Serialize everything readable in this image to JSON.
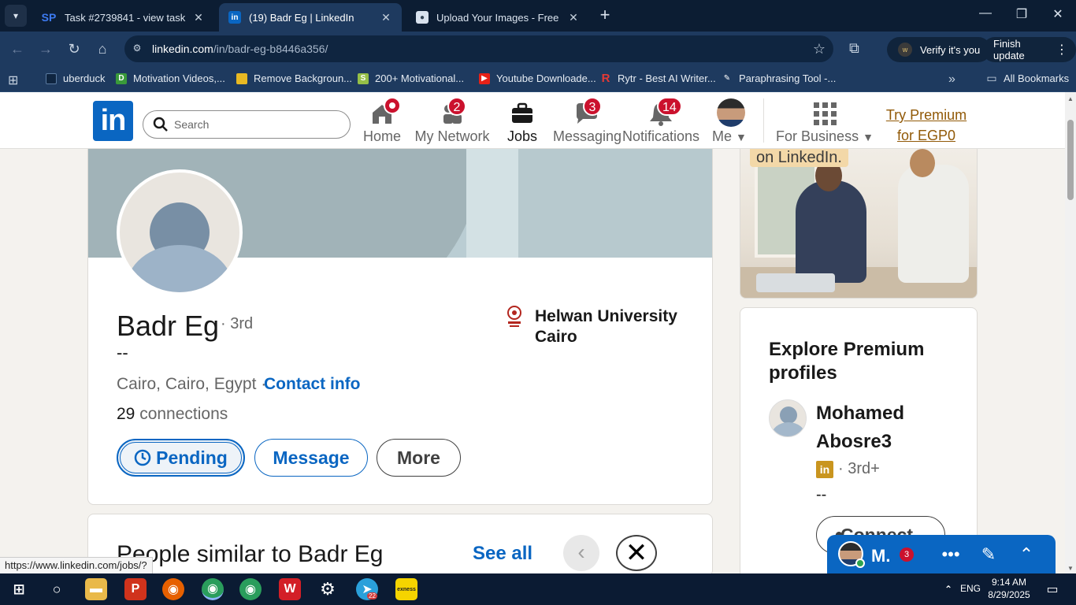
{
  "browser": {
    "tabs": [
      {
        "title": "Task #2739841 - view task",
        "favicon": "sp-icon",
        "active": false
      },
      {
        "title": "(19) Badr Eg | LinkedIn",
        "favicon": "linkedin-icon",
        "active": true
      },
      {
        "title": "Upload Your Images - Free Imag",
        "favicon": "image-host-icon",
        "active": false
      }
    ],
    "url_domain": "linkedin.com",
    "url_path": "/in/badr-eg-b8446a356/",
    "verify_label": "Verify it's you",
    "update_label": "Finish update",
    "bookmarks": [
      {
        "label": "uberduck",
        "color": "#1e3a5f"
      },
      {
        "label": "Motivation Videos,...",
        "color": "#3a9a3a"
      },
      {
        "label": "Remove Backgroun...",
        "color": "#e8b923"
      },
      {
        "label": "200+ Motivational...",
        "color": "#95bf47"
      },
      {
        "label": "Youtube Downloade...",
        "color": "#e62117"
      },
      {
        "label": "Rytr - Best AI Writer...",
        "color": "#e53935"
      },
      {
        "label": "Paraphrasing Tool -...",
        "color": "#ffffff"
      }
    ],
    "all_bookmarks_label": "All Bookmarks",
    "status_url": "https://www.linkedin.com/jobs/?"
  },
  "header": {
    "logo_text": "in",
    "search_placeholder": "Search",
    "nav": {
      "home": {
        "label": "Home",
        "badge": ""
      },
      "network": {
        "label": "My Network",
        "badge": "2"
      },
      "jobs": {
        "label": "Jobs",
        "badge": ""
      },
      "messaging": {
        "label": "Messaging",
        "badge": "3"
      },
      "notifications": {
        "label": "Notifications",
        "badge": "14"
      },
      "me": {
        "label": "Me"
      },
      "business": {
        "label": "For Business"
      }
    },
    "premium_line1": "Try Premium",
    "premium_line2": "for EGP0"
  },
  "profile": {
    "name": "Badr Eg",
    "degree": "· 3rd",
    "headline": "--",
    "location": "Cairo, Cairo, Egypt ·",
    "contact_info": "Contact info",
    "connections_count": "29",
    "connections_label": " connections",
    "buttons": {
      "pending": "Pending",
      "message": "Message",
      "more": "More"
    },
    "education": "Helwan University Cairo"
  },
  "similar": {
    "title": "People similar to Badr Eg",
    "see_all": "See all",
    "prev": "‹",
    "close": "✕"
  },
  "sidebar": {
    "ad_text": "on LinkedIn.",
    "premium_title": "Explore Premium profiles",
    "person": {
      "name": "Mohamed Abosre3",
      "degree": "· 3rd+",
      "headline": "--",
      "connect_label": "Connect"
    }
  },
  "messaging_bar": {
    "initial": "M.",
    "badge": "3"
  },
  "taskbar": {
    "lang": "ENG",
    "time": "9:14 AM",
    "date": "8/29/2025",
    "telegram_badge": "22"
  }
}
